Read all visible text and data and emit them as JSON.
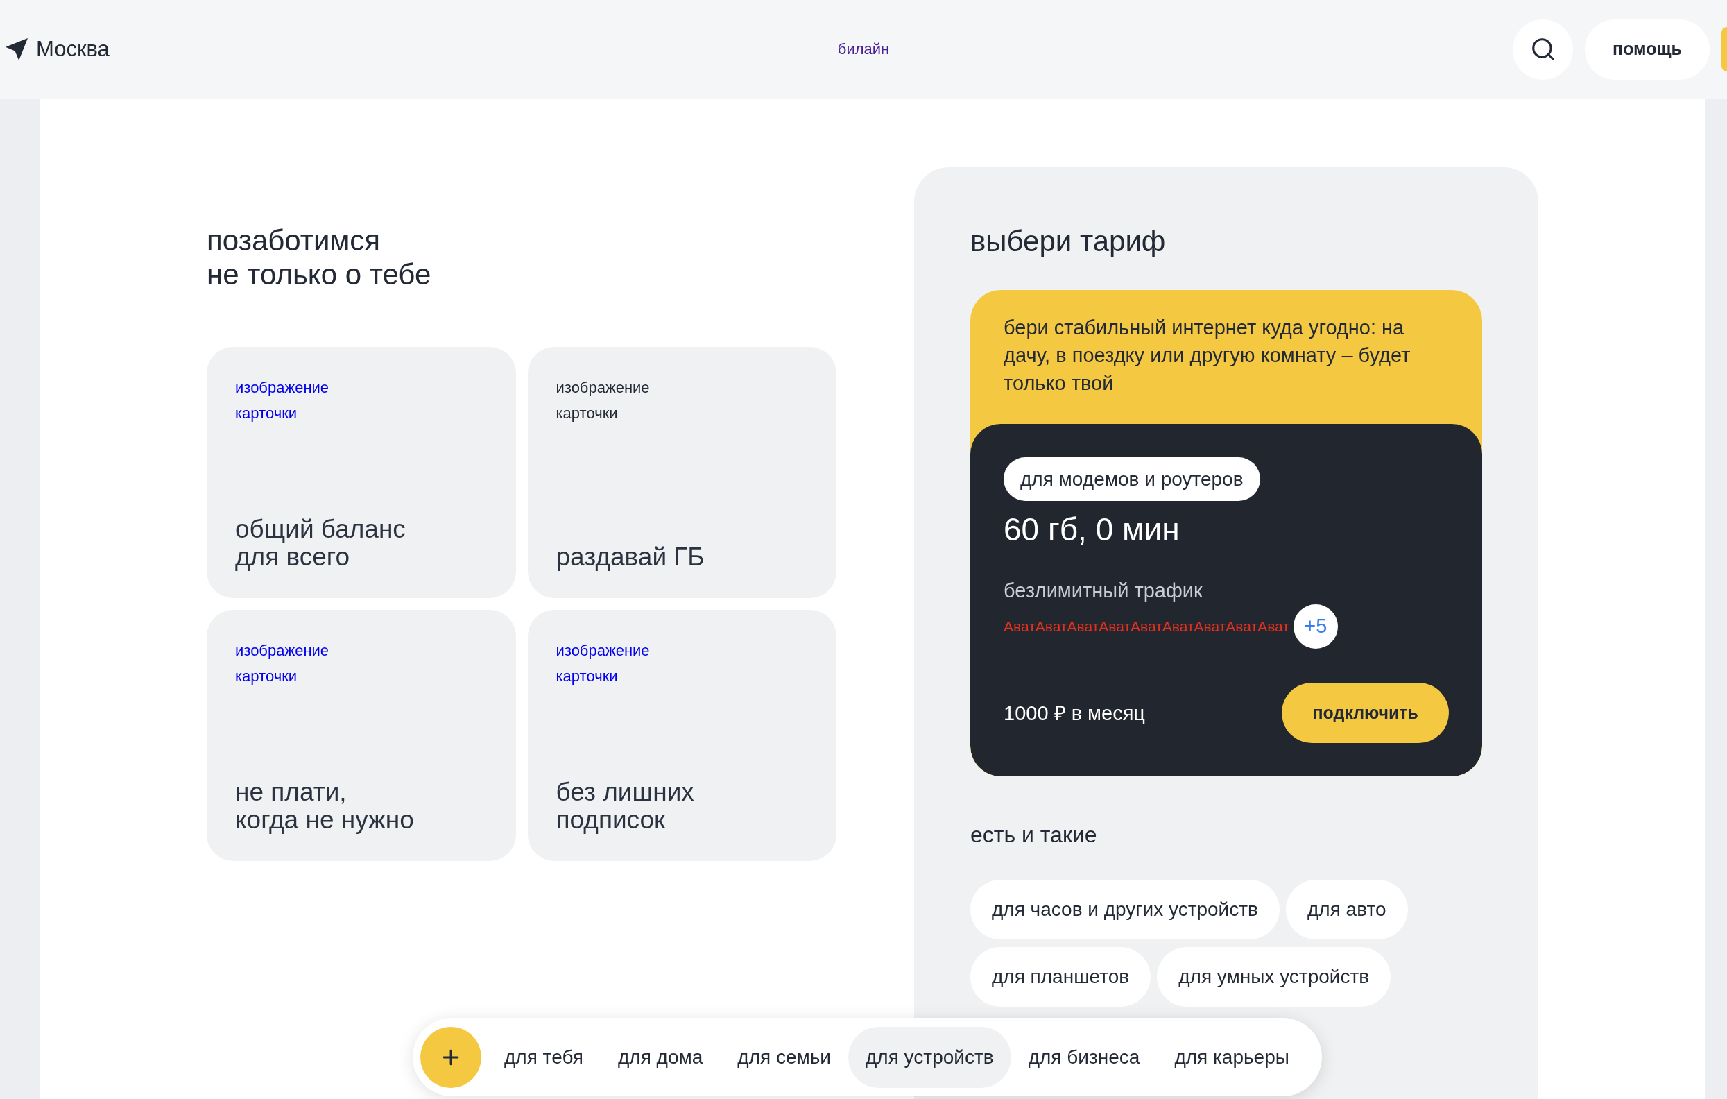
{
  "header": {
    "city": "Москва",
    "brand": "билайн",
    "help_button": "помощь"
  },
  "care_section": {
    "title_lines": [
      "позаботимся",
      "не только о тебе"
    ],
    "cards": [
      {
        "image_alt": "изображение карточки",
        "image_alt_link": true,
        "title_lines": [
          "общий баланс",
          "для всего"
        ]
      },
      {
        "image_alt": "изображение карточки",
        "image_alt_link": false,
        "title_lines": [
          "раздавай ГБ"
        ]
      },
      {
        "image_alt": "изображение карточки",
        "image_alt_link": true,
        "title_lines": [
          "не плати,",
          "когда не нужно"
        ]
      },
      {
        "image_alt": "изображение карточки",
        "image_alt_link": true,
        "title_lines": [
          "без лишних",
          "подписок"
        ]
      }
    ]
  },
  "tariff_panel": {
    "title": "выбери тариф",
    "tariff": {
      "description_lines": [
        "бери стабильный интернет куда угодно: на",
        "дачу, в поездку или другую комнату – будет",
        "только твой"
      ],
      "tag": "для модемов и роутеров",
      "volume": "60 гб, 0 мин",
      "feature": "безлимитный трафик",
      "avatars": [
        "Ават",
        "Ават",
        "Ават",
        "Ават",
        "Ават",
        "Ават",
        "Ават",
        "Ават",
        "Ават"
      ],
      "avatars_more": "+5",
      "price": "1000 ₽ в месяц",
      "button": "подключить"
    },
    "more_title": "есть и такие",
    "more_options": [
      "для часов и других устройств",
      "для авто",
      "для планшетов",
      "для умных устройств"
    ]
  },
  "bottom_nav": {
    "items": [
      {
        "label": "для тебя",
        "selected": false
      },
      {
        "label": "для дома",
        "selected": false
      },
      {
        "label": "для семьи",
        "selected": false
      },
      {
        "label": "для устройств",
        "selected": true
      },
      {
        "label": "для бизнеса",
        "selected": false
      },
      {
        "label": "для карьеры",
        "selected": false
      }
    ]
  }
}
